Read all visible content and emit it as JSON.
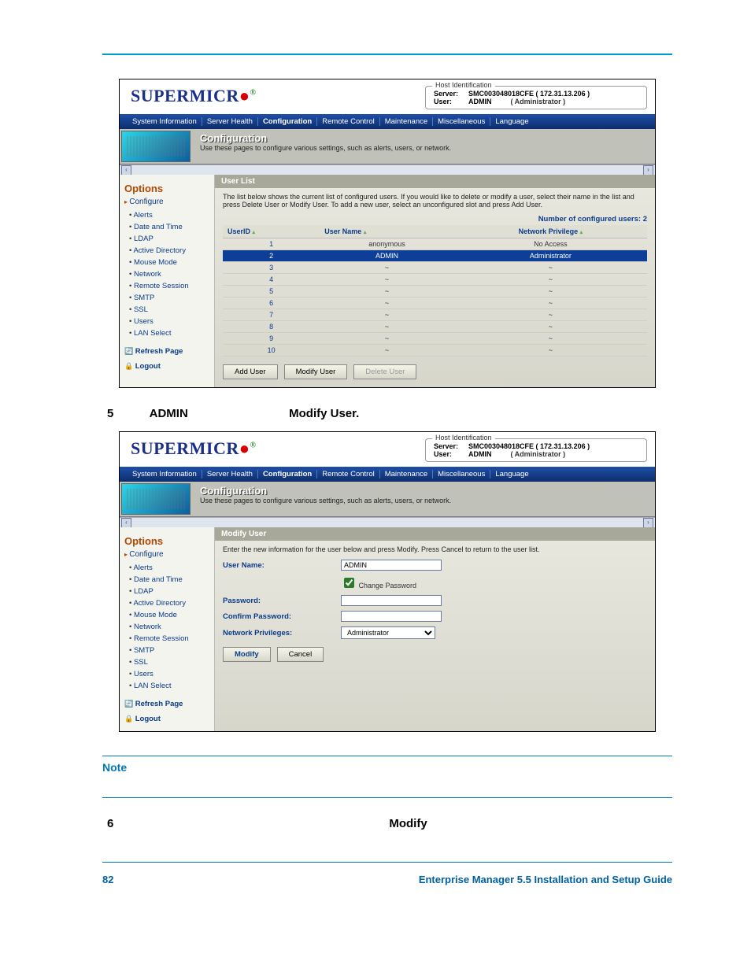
{
  "logo": "SUPERMICR",
  "host_id_legend": "Host Identification",
  "host": {
    "server_label": "Server:",
    "server_value": "SMC003048018CFE ( 172.31.13.206 )",
    "user_label": "User:",
    "user_value": "ADMIN",
    "role": "( Administrator )"
  },
  "menu": {
    "items": [
      "System Information",
      "Server Health",
      "Configuration",
      "Remote Control",
      "Maintenance",
      "Miscellaneous",
      "Language"
    ],
    "active": "Configuration"
  },
  "config_title": "Configuration",
  "config_desc": "Use these pages to configure various settings, such as alerts, users, or network.",
  "sidebar": {
    "header": "Options",
    "configure": "Configure",
    "items": [
      "Alerts",
      "Date and Time",
      "LDAP",
      "Active Directory",
      "Mouse Mode",
      "Network",
      "Remote Session",
      "SMTP",
      "SSL",
      "Users",
      "LAN Select"
    ],
    "refresh": "Refresh Page",
    "logout": "Logout"
  },
  "userlist": {
    "title": "User List",
    "desc": "The list below shows the current list of configured users. If you would like to delete or modify a user, select their name in the list and press Delete User or Modify User. To add a new user, select an unconfigured slot and press Add User.",
    "count": "Number of configured users: 2",
    "cols": {
      "id": "UserID",
      "name": "User Name",
      "priv": "Network Privilege"
    },
    "rows": [
      {
        "id": "1",
        "name": "anonymous",
        "priv": "No Access",
        "sel": false
      },
      {
        "id": "2",
        "name": "ADMIN",
        "priv": "Administrator",
        "sel": true
      },
      {
        "id": "3",
        "name": "~",
        "priv": "~",
        "sel": false
      },
      {
        "id": "4",
        "name": "~",
        "priv": "~",
        "sel": false
      },
      {
        "id": "5",
        "name": "~",
        "priv": "~",
        "sel": false
      },
      {
        "id": "6",
        "name": "~",
        "priv": "~",
        "sel": false
      },
      {
        "id": "7",
        "name": "~",
        "priv": "~",
        "sel": false
      },
      {
        "id": "8",
        "name": "~",
        "priv": "~",
        "sel": false
      },
      {
        "id": "9",
        "name": "~",
        "priv": "~",
        "sel": false
      },
      {
        "id": "10",
        "name": "~",
        "priv": "~",
        "sel": false
      }
    ],
    "buttons": {
      "add": "Add User",
      "modify": "Modify User",
      "delete": "Delete User"
    }
  },
  "modifyuser": {
    "title": "Modify User",
    "desc": "Enter the new information for the user below and press Modify. Press Cancel to return to the user list.",
    "username_label": "User Name:",
    "username_value": "ADMIN",
    "change_pw": "Change Password",
    "password_label": "Password:",
    "confirm_label": "Confirm Password:",
    "priv_label": "Network Privileges:",
    "priv_value": "Administrator",
    "modify_btn": "Modify",
    "cancel_btn": "Cancel"
  },
  "doc": {
    "step5_num": "5",
    "step5_a": "ADMIN",
    "step5_b": "Modify User.",
    "step6_num": "6",
    "step6_b": "Modify",
    "note": "Note",
    "page_num": "82",
    "guide": "Enterprise Manager 5.5 Installation and Setup Guide"
  }
}
